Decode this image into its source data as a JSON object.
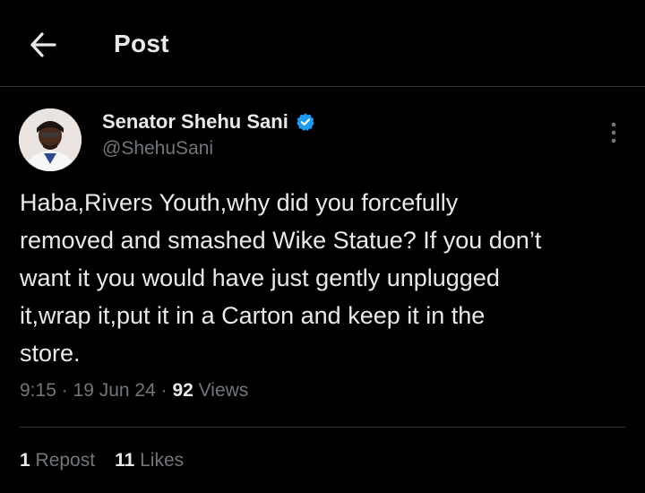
{
  "header": {
    "title": "Post"
  },
  "author": {
    "display_name": "Senator Shehu Sani",
    "handle": "@ShehuSani",
    "verified": true
  },
  "tweet": {
    "text": "Haba,Rivers Youth,why did you forcefully\nremoved and smashed Wike Statue? If you don’t\nwant it you would have just gently unplugged\nit,wrap it,put it in a Carton and keep it in the\nstore."
  },
  "meta": {
    "time": "9:15",
    "sep1": " · ",
    "date": "19 Jun 24",
    "sep2": " · ",
    "views_count": "92",
    "views_label": " Views"
  },
  "stats": {
    "reposts_count": "1",
    "reposts_label": " Repost",
    "likes_count": "11",
    "likes_label": " Likes"
  },
  "icons": {
    "back": "arrow-left-icon",
    "verified": "verified-badge-icon",
    "more": "more-vertical-icon"
  },
  "colors": {
    "background": "#000000",
    "text_primary": "#e7e9ea",
    "text_secondary": "#71767b",
    "verified_blue": "#1d9bf0",
    "divider": "#2f3336"
  }
}
